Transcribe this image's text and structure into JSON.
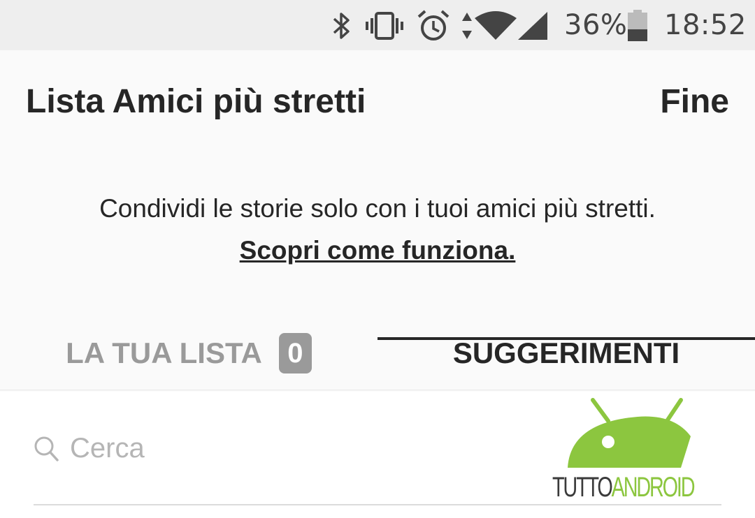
{
  "status_bar": {
    "battery": "36%",
    "time": "18:52",
    "icons": [
      "bluetooth-icon",
      "vibrate-icon",
      "alarm-icon",
      "data-arrows-icon",
      "wifi-icon",
      "signal-icon",
      "battery-icon"
    ]
  },
  "header": {
    "title": "Lista Amici più stretti",
    "done_label": "Fine"
  },
  "description": {
    "text": "Condividi le storie solo con i tuoi amici più stretti.",
    "link_label": "Scopri come funziona."
  },
  "tabs": {
    "list_label": "LA TUA LISTA",
    "list_count": "0",
    "suggestions_label": "SUGGERIMENTI",
    "active": "SUGGERIMENTI"
  },
  "search": {
    "placeholder": "Cerca"
  },
  "watermark": {
    "part1": "TUTTO",
    "part2": "ANDROID"
  },
  "colors": {
    "status_bar_bg": "#eeeeee",
    "header_bg": "#fafafa",
    "text_primary": "#262626",
    "text_muted": "#9a9a9a",
    "brand_green": "#8cc63f"
  }
}
